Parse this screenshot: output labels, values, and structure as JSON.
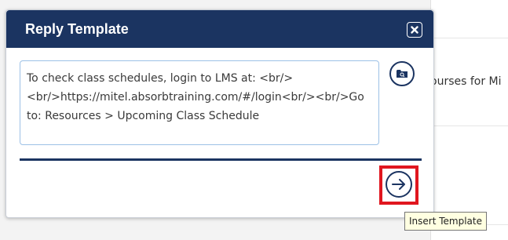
{
  "background": {
    "partial_text": "ourses for Mi"
  },
  "dialog": {
    "title": "Reply Template",
    "close_icon": "close-icon",
    "template_text": "To check class schedules, login to LMS at: <br/><br/>https://mitel.absorbtraining.com/#/login<br/><br/>Go to: Resources > Upcoming Class Schedule",
    "preview_icon": "folder-search-icon",
    "insert_icon": "arrow-right-icon",
    "insert_tooltip": "Insert Template"
  },
  "colors": {
    "header": "#1b3461",
    "highlight": "#e0161f",
    "textarea_border": "#9dc1e6"
  }
}
